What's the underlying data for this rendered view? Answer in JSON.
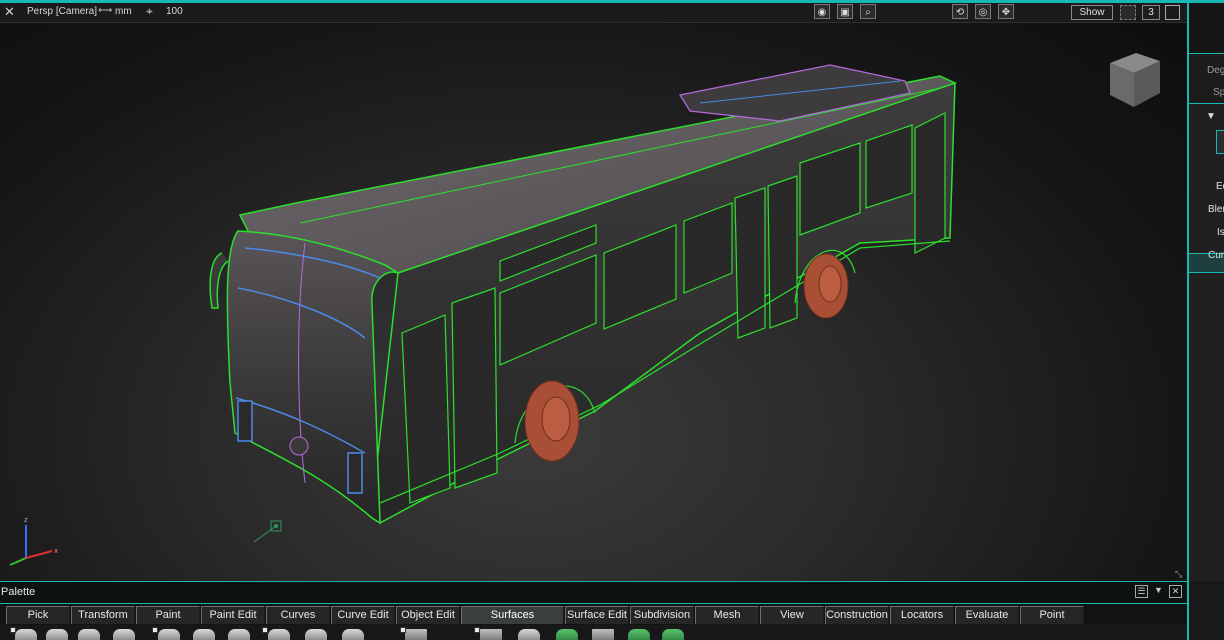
{
  "viewport": {
    "title": "Persp [Camera]",
    "units": "mm",
    "scale": "100",
    "show_label": "Show",
    "layout_number": "3",
    "header_icons_left": [
      "camera-icon",
      "snapshot-icon",
      "zoom-icon"
    ],
    "header_icons_right": [
      "tumble-icon",
      "sphere-icon",
      "move-icon"
    ]
  },
  "side_panel": {
    "labels": [
      "Deg",
      "Sp",
      "D",
      "Ed",
      "Blen",
      "Is",
      "Cur"
    ]
  },
  "palette": {
    "title": "Palette",
    "tabs": [
      "Pick",
      "Transform",
      "Paint",
      "Paint Edit",
      "Curves",
      "Curve Edit",
      "Object Edit",
      "Surfaces",
      "Surface Edit",
      "Subdivision",
      "Mesh",
      "View",
      "Construction",
      "Locators",
      "Evaluate",
      "Point Clouds"
    ],
    "active_tab": "Surfaces"
  },
  "colors": {
    "accent": "#18b7b4",
    "wire_green": "#2ddf2d",
    "wire_purple": "#b46be0",
    "wire_blue": "#4a8be6",
    "wheel": "#a84f35"
  }
}
